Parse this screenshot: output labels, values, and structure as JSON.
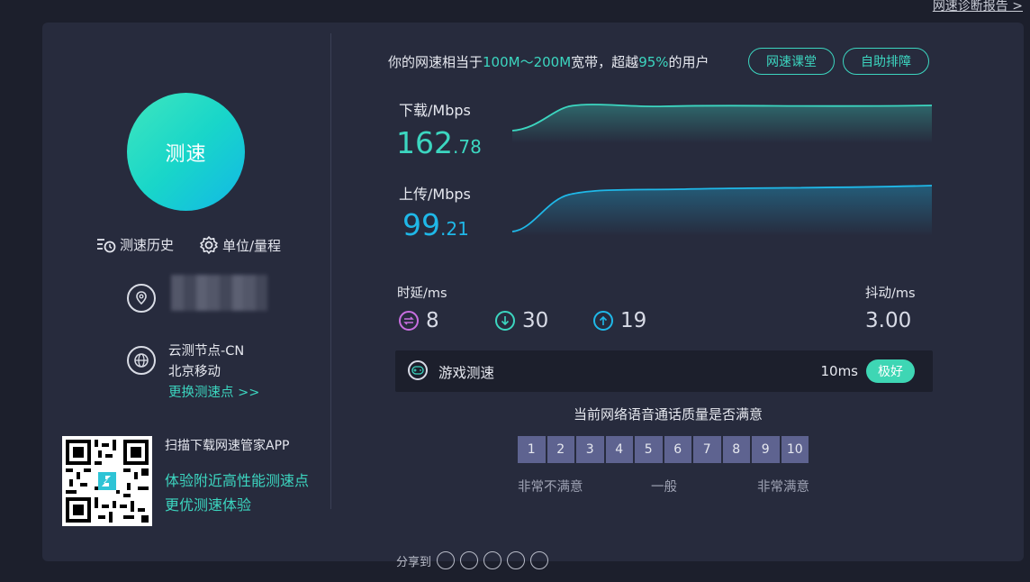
{
  "top_link": "网速诊断报告 >",
  "left": {
    "speed_button": "测速",
    "history_label": "测速历史",
    "unit_label": "单位/量程",
    "node_line1": "云测节点-CN",
    "node_line2": "北京移动",
    "change_node": "更换测速点 >>",
    "qr_text": "扫描下载网速管家APP",
    "qr_green1": "体验附近高性能测速点",
    "qr_green2": "更优测速体验"
  },
  "summary": {
    "prefix": "你的网速相当于",
    "range": "100M～200M",
    "mid": "宽带，超越",
    "percent": "95%",
    "suffix": "的用户"
  },
  "buttons": {
    "course": "网速课堂",
    "troubleshoot": "自助排障"
  },
  "download": {
    "label": "下载/Mbps",
    "int": "162",
    "dec": ".78"
  },
  "upload": {
    "label": "上传/Mbps",
    "int": "99",
    "dec": ".21"
  },
  "latency": {
    "label": "时延/ms",
    "ping": "8",
    "down": "30",
    "up": "19",
    "jitter_label": "抖动/ms",
    "jitter": "3.00"
  },
  "game": {
    "label": "游戏测速",
    "ms": "10ms",
    "badge": "极好"
  },
  "survey": {
    "question": "当前网络语音通话质量是否满意",
    "scores": [
      "1",
      "2",
      "3",
      "4",
      "5",
      "6",
      "7",
      "8",
      "9",
      "10"
    ],
    "low": "非常不满意",
    "mid": "一般",
    "high": "非常满意"
  },
  "share_label": "分享到",
  "colors": {
    "accent_green": "#3cd6c0",
    "accent_blue": "#1fb8e8",
    "panel": "#272b3d"
  }
}
